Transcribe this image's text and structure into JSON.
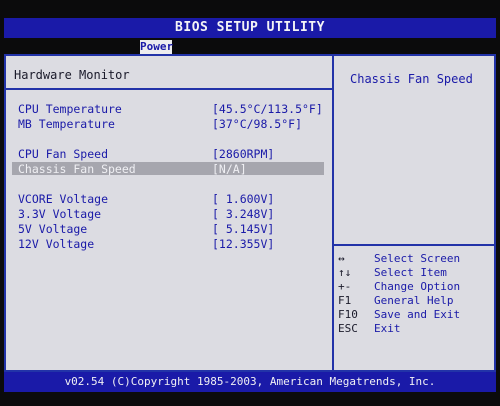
{
  "app": {
    "title": "BIOS SETUP UTILITY",
    "active_tab": "Power"
  },
  "left": {
    "section_title": "Hardware Monitor",
    "items": [
      {
        "label": "CPU Temperature",
        "value": "[45.5°C/113.5°F]"
      },
      {
        "label": "MB Temperature",
        "value": "[37°C/98.5°F]"
      },
      {
        "label": "CPU Fan Speed",
        "value": "[2860RPM]"
      },
      {
        "label": "Chassis Fan Speed",
        "value": "[N/A]"
      },
      {
        "label": "VCORE  Voltage",
        "value": "[ 1.600V]"
      },
      {
        "label": "3.3V  Voltage",
        "value": "[ 3.248V]"
      },
      {
        "label": "5V  Voltage",
        "value": "[ 5.145V]"
      },
      {
        "label": "12V  Voltage",
        "value": "[12.355V]"
      }
    ]
  },
  "help": {
    "title": "Chassis Fan Speed",
    "keys": [
      {
        "key": "↔",
        "action": "Select Screen"
      },
      {
        "key": "↑↓",
        "action": "Select Item"
      },
      {
        "key": "+-",
        "action": "Change Option"
      },
      {
        "key": "F1",
        "action": "General Help"
      },
      {
        "key": "F10",
        "action": "Save and Exit"
      },
      {
        "key": "ESC",
        "action": "Exit"
      }
    ]
  },
  "footer": {
    "text": "v02.54 (C)Copyright 1985-2003, American Megatrends, Inc."
  }
}
